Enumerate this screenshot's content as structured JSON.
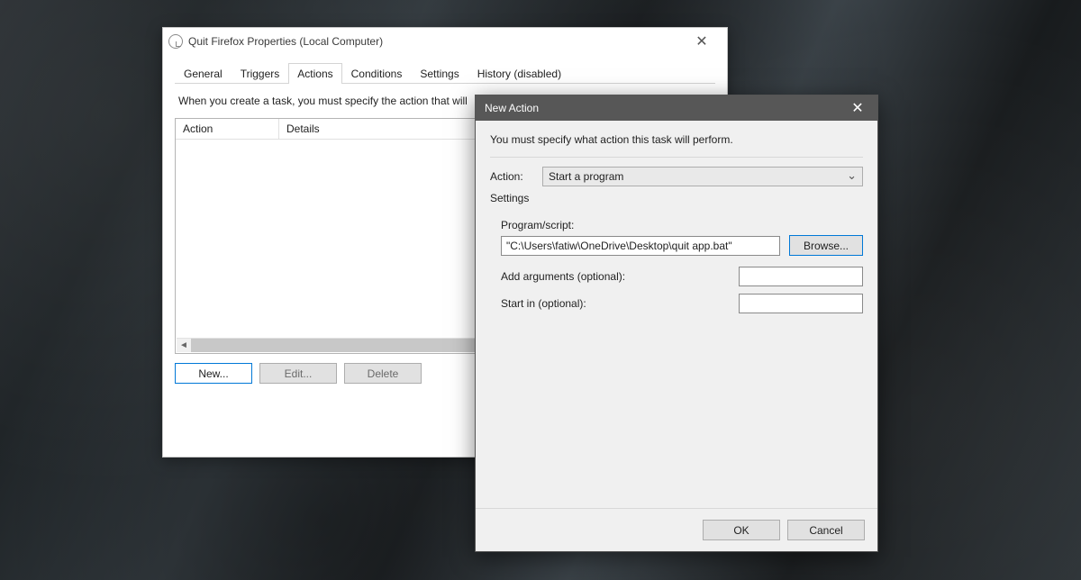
{
  "propsWindow": {
    "title": "Quit Firefox Properties (Local Computer)",
    "tabs": {
      "general": "General",
      "triggers": "Triggers",
      "actions": "Actions",
      "conditions": "Conditions",
      "settings": "Settings",
      "history": "History (disabled)"
    },
    "instruction": "When you create a task, you must specify the action that will",
    "columns": {
      "action": "Action",
      "details": "Details"
    },
    "buttons": {
      "new": "New...",
      "edit": "Edit...",
      "delete": "Delete"
    }
  },
  "newAction": {
    "title": "New Action",
    "instruction": "You must specify what action this task will perform.",
    "actionLabel": "Action:",
    "actionSelected": "Start a program",
    "settingsLabel": "Settings",
    "programLabel": "Program/script:",
    "programValue": "\"C:\\Users\\fatiw\\OneDrive\\Desktop\\quit app.bat\"",
    "browse": "Browse...",
    "argsLabel": "Add arguments (optional):",
    "argsValue": "",
    "startInLabel": "Start in (optional):",
    "startInValue": "",
    "ok": "OK",
    "cancel": "Cancel"
  }
}
